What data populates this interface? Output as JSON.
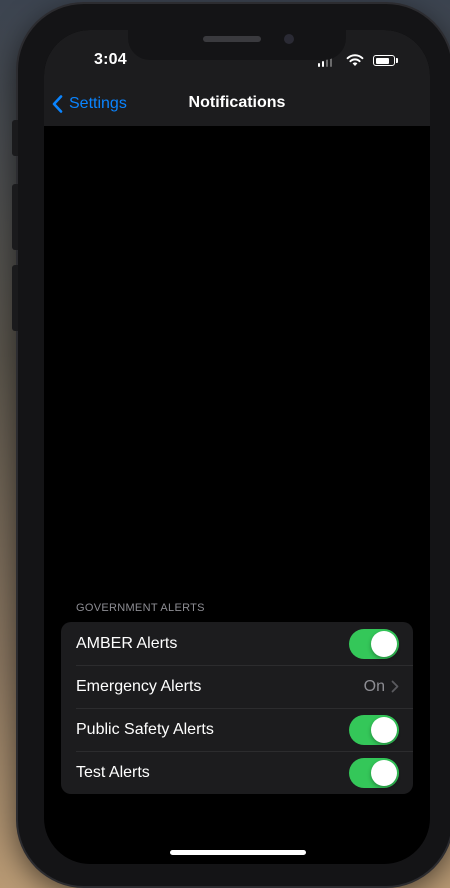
{
  "status_bar": {
    "time": "3:04"
  },
  "nav": {
    "back_label": "Settings",
    "title": "Notifications"
  },
  "government_alerts": {
    "section_title": "GOVERNMENT ALERTS",
    "items": [
      {
        "label": "AMBER Alerts",
        "control": "toggle",
        "on": true
      },
      {
        "label": "Emergency Alerts",
        "control": "disclosure",
        "value": "On"
      },
      {
        "label": "Public Safety Alerts",
        "control": "toggle",
        "on": true
      },
      {
        "label": "Test Alerts",
        "control": "toggle",
        "on": true
      }
    ]
  },
  "icons": {
    "back": "chevron-left-icon",
    "disclosure": "chevron-right-icon",
    "signal": "cellular-signal-icon",
    "wifi": "wifi-icon",
    "battery": "battery-icon"
  },
  "colors": {
    "accent": "#0a84ff",
    "toggle_on": "#34c759",
    "group_background": "#1c1c1e",
    "screen_background": "#000000",
    "secondary_text": "#8d8d93"
  }
}
